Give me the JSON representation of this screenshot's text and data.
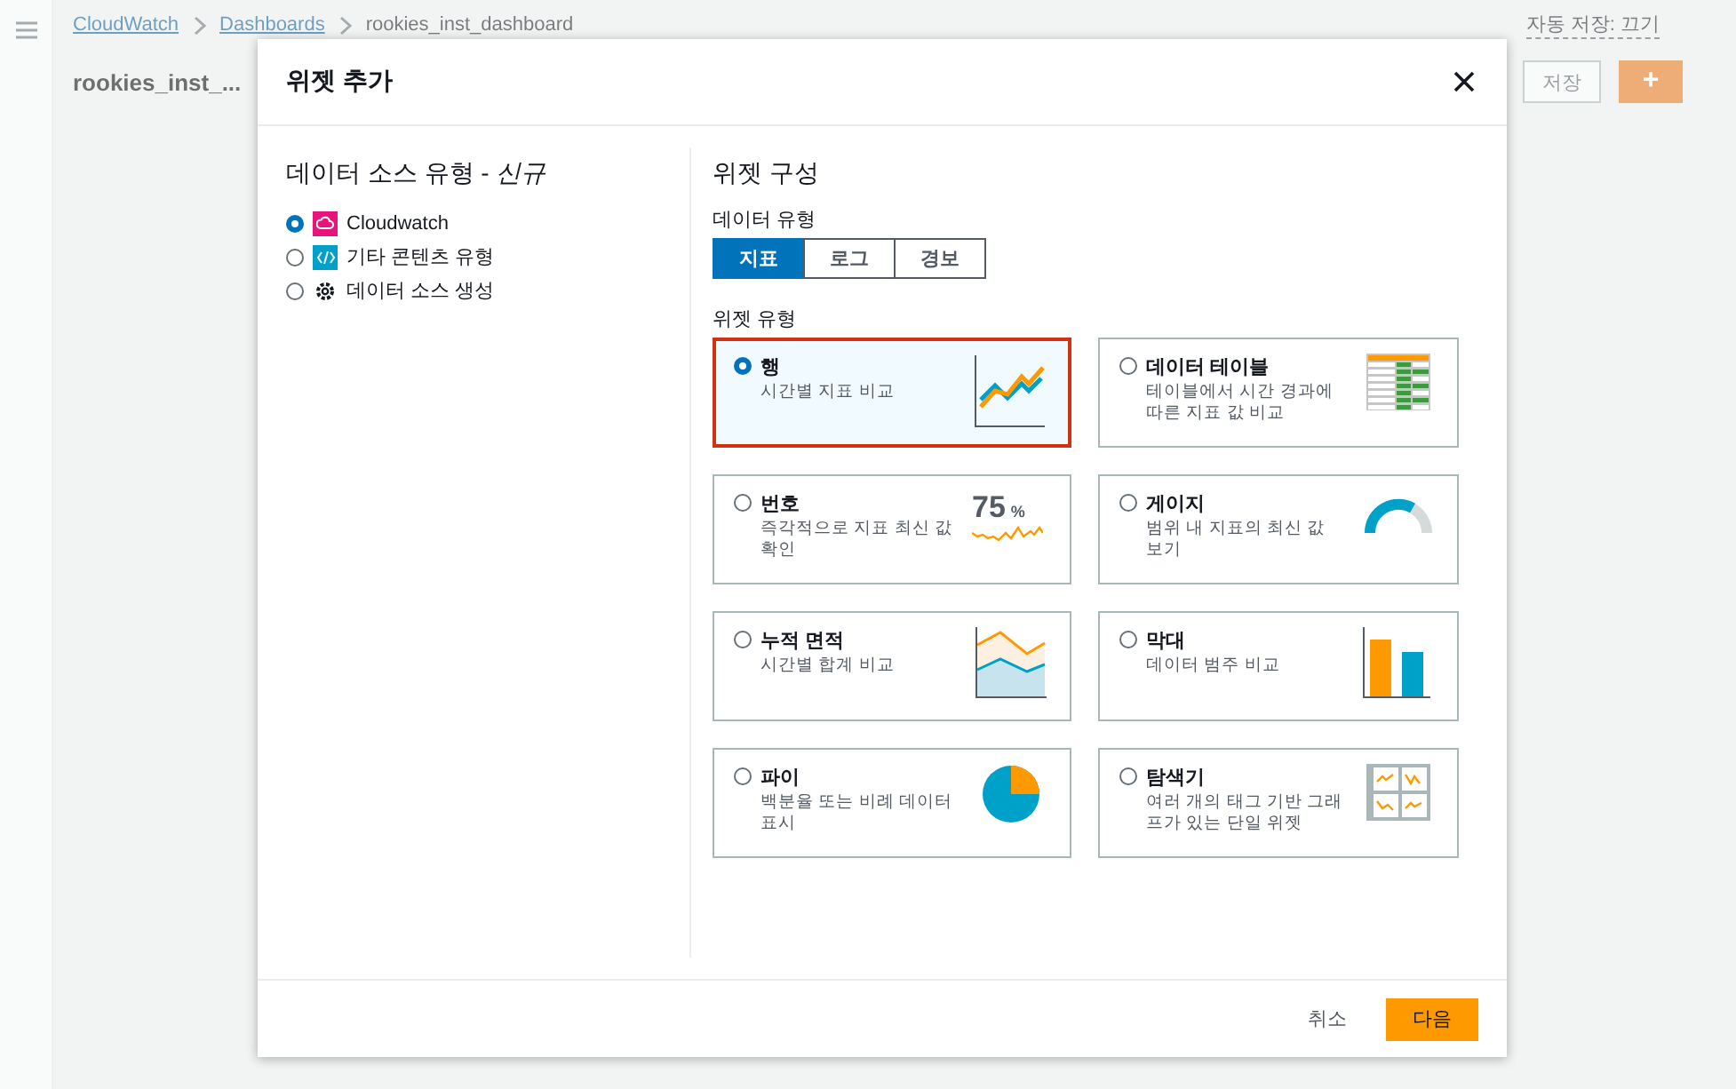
{
  "background": {
    "breadcrumbs": [
      "CloudWatch",
      "Dashboards",
      "rookies_inst_dashboard"
    ],
    "dashboard_title": "rookies_inst_...",
    "autosave": "자동 저장: 끄기",
    "save_button": "저장",
    "add_button": "+"
  },
  "dialog": {
    "title": "위젯 추가",
    "data_source": {
      "heading": "데이터 소스 유형 - ",
      "heading_em": "신규",
      "options": [
        {
          "label": "Cloudwatch",
          "kind": "cloudwatch",
          "selected": true
        },
        {
          "label": "기타 콘텐츠 유형",
          "kind": "code",
          "selected": false
        },
        {
          "label": "데이터 소스 생성",
          "kind": "gear",
          "selected": false
        }
      ]
    },
    "config": {
      "heading": "위젯 구성",
      "data_type_label": "데이터 유형",
      "data_types": [
        {
          "label": "지표",
          "selected": true
        },
        {
          "label": "로그",
          "selected": false
        },
        {
          "label": "경보",
          "selected": false
        }
      ],
      "widget_type_label": "위젯 유형",
      "widget_types": [
        {
          "title": "행",
          "description": "시간별 지표 비교",
          "kind": "line",
          "selected": true
        },
        {
          "title": "데이터 테이블",
          "description": "테이블에서 시간 경과에 따른 지표 값 비교",
          "kind": "table",
          "selected": false
        },
        {
          "title": "번호",
          "description": "즉각적으로 지표 최신 값 확인",
          "kind": "number",
          "value_text": "75",
          "unit_text": "%",
          "selected": false
        },
        {
          "title": "게이지",
          "description": "범위 내 지표의 최신 값 보기",
          "kind": "gauge",
          "selected": false
        },
        {
          "title": "누적 면적",
          "description": "시간별 합계 비교",
          "kind": "area",
          "selected": false
        },
        {
          "title": "막대",
          "description": "데이터 범주 비교",
          "kind": "bar",
          "selected": false
        },
        {
          "title": "파이",
          "description": "백분율 또는 비례 데이터 표시",
          "kind": "pie",
          "selected": false
        },
        {
          "title": "탐색기",
          "description": "여러 개의 태그 기반 그래프가 있는 단일 위젯",
          "kind": "explorer",
          "selected": false
        }
      ]
    },
    "cancel_button": "취소",
    "next_button": "다음"
  }
}
